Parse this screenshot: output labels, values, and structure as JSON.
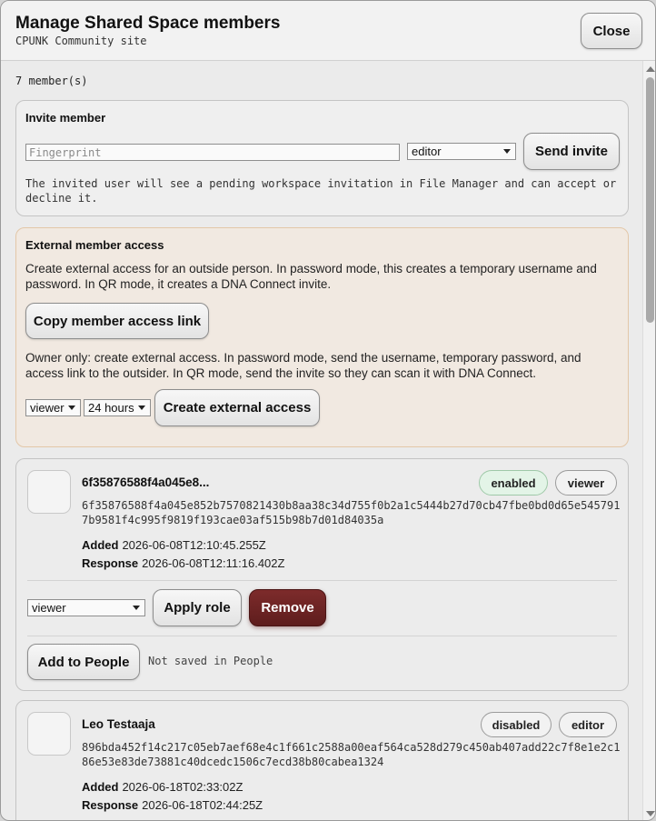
{
  "dialog": {
    "title": "Manage Shared Space members",
    "subtitle": "CPUNK Community site",
    "close_label": "Close"
  },
  "member_count": "7 member(s)",
  "invite": {
    "title": "Invite member",
    "fingerprint_placeholder": "Fingerprint",
    "fingerprint_value": "",
    "role_selected": "editor",
    "send_label": "Send invite",
    "help": "The invited user will see a pending workspace invitation in File Manager and can accept or decline it."
  },
  "external": {
    "title": "External member access",
    "description": "Create external access for an outside person. In password mode, this creates a temporary username and password. In QR mode, it creates a DNA Connect invite.",
    "copy_link_label": "Copy member access link",
    "owner_note": "Owner only: create external access. In password mode, send the username, temporary password, and access link to the outsider. In QR mode, send the invite so they can scan it with DNA Connect.",
    "role_selected": "viewer",
    "duration_selected": "24 hours",
    "create_label": "Create external access"
  },
  "members": [
    {
      "name": "6f35876588f4a045e8...",
      "fingerprint": "6f35876588f4a045e852b7570821430b8aa38c34d755f0b2a1c5444b27d70cb47fbe0bd0d65e5457917b9581f4c995f9819f193cae03af515b98b7d01d84035a",
      "status": "enabled",
      "role": "viewer",
      "added_label": "Added",
      "added": "2026-06-08T12:10:45.255Z",
      "response_label": "Response",
      "response": "2026-06-08T12:11:16.402Z",
      "role_select": "viewer",
      "apply_label": "Apply role",
      "remove_label": "Remove",
      "add_people_label": "Add to People",
      "people_note": "Not saved in People"
    },
    {
      "name": "Leo Testaaja",
      "fingerprint": "896bda452f14c217c05eb7aef68e4c1f661c2588a00eaf564ca528d279c450ab407add22c7f8e1e2c186e53e83de73881c40dcedc1506c7ecd38b80cabea1324",
      "status": "disabled",
      "role": "editor",
      "added_label": "Added",
      "added": "2026-06-18T02:33:02Z",
      "response_label": "Response",
      "response": "2026-06-18T02:44:25Z"
    }
  ],
  "colors": {
    "remove_button": "#6b2424",
    "external_panel_bg": "#f1e9e1",
    "enabled_badge_bg": "#e3f4e7"
  }
}
